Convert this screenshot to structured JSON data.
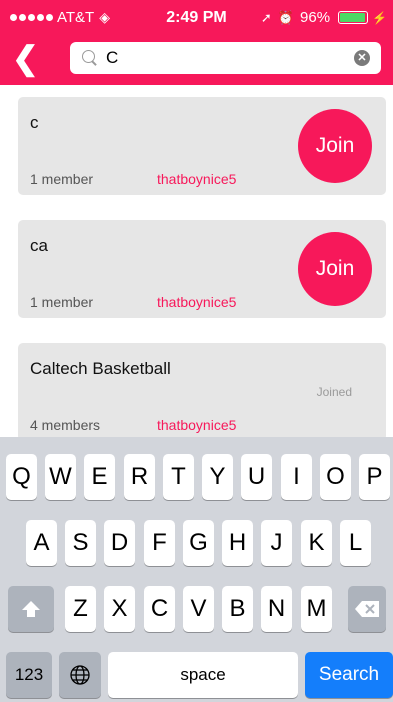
{
  "status_bar": {
    "carrier": "AT&T",
    "time": "2:49 PM",
    "battery_text": "96%",
    "battery_level": 0.96
  },
  "header": {
    "search_value": "C",
    "accent_color": "#f7185a"
  },
  "groups": [
    {
      "name": "c",
      "members": "1 member",
      "owner": "thatboynice5",
      "action": "Join"
    },
    {
      "name": "ca",
      "members": "1 member",
      "owner": "thatboynice5",
      "action": "Join"
    },
    {
      "name": "Caltech Basketball",
      "members": "4 members",
      "owner": "thatboynice5",
      "status": "Joined"
    }
  ],
  "keyboard": {
    "row1": [
      "Q",
      "W",
      "E",
      "R",
      "T",
      "Y",
      "U",
      "I",
      "O",
      "P"
    ],
    "row2": [
      "A",
      "S",
      "D",
      "F",
      "G",
      "H",
      "J",
      "K",
      "L"
    ],
    "row3": [
      "Z",
      "X",
      "C",
      "V",
      "B",
      "N",
      "M"
    ],
    "numbers_label": "123",
    "space_label": "space",
    "search_label": "Search",
    "icons": [
      "shift-icon",
      "backspace-icon",
      "globe-icon"
    ]
  }
}
